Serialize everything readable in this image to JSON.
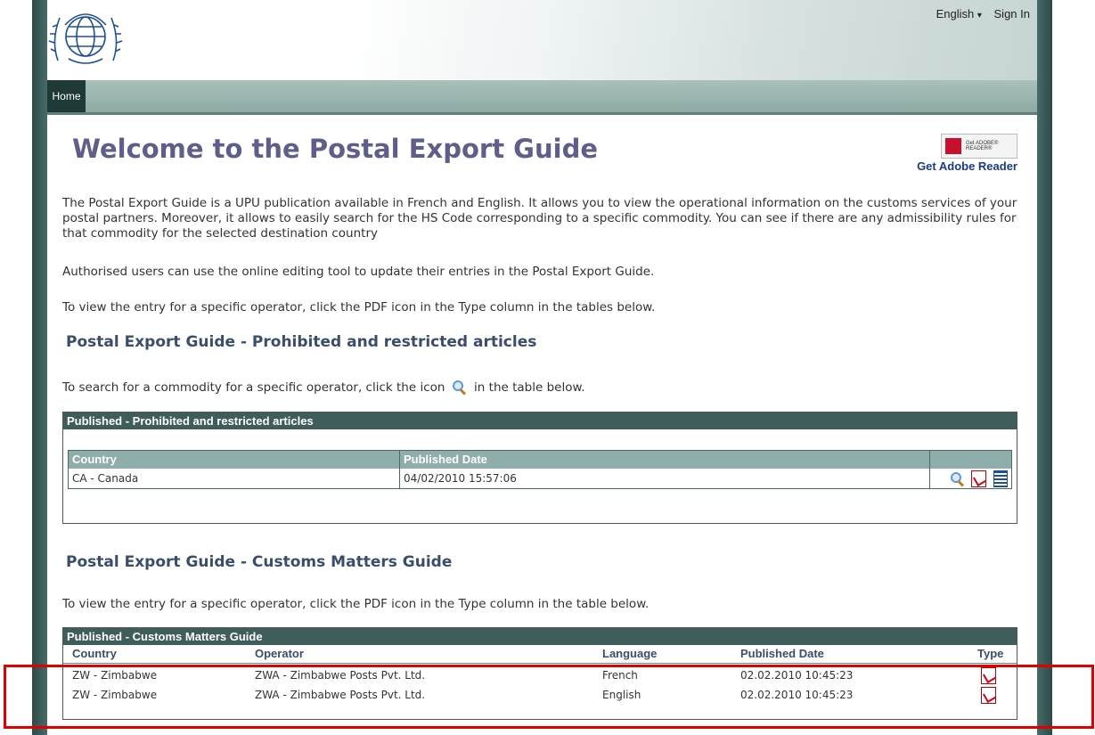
{
  "header": {
    "language_label": "English",
    "language_caret": "▾",
    "sign_in_label": "Sign In"
  },
  "nav": {
    "home_label": "Home"
  },
  "main": {
    "title": "Welcome to the Postal Export Guide",
    "adobe_badge_text": "Get ADOBE® READER®",
    "adobe_link": "Get Adobe Reader",
    "intro": "The Postal Export Guide is a UPU publication available in French and English. It allows you to view the operational information on the customs services of your postal partners. Moreover, it allows to easily search for the HS Code corresponding to a specific commodity. You can see if there are any admissibility rules for that commodity for the selected destination country",
    "authorised": "Authorised users can use the online editing tool to update their entries in the Postal Export Guide.",
    "view_entry": "To view the entry for a specific operator, click the PDF icon in the Type column in the tables below."
  },
  "section1": {
    "heading": "Postal Export Guide - Prohibited and restricted articles",
    "search_text_before": "To search for a commodity for a specific operator, click the icon",
    "search_text_after": "in the table below.",
    "panel_title": "Published - Prohibited and restricted articles",
    "col_country": "Country",
    "col_published": "Published Date",
    "rows": [
      {
        "country": "CA - Canada",
        "published": "04/02/2010 15:57:06"
      }
    ]
  },
  "section2": {
    "heading": "Postal Export Guide - Customs Matters Guide",
    "view_text": "To view the entry for a specific operator, click the PDF icon in the Type column in the table below.",
    "panel_title": "Published - Customs Matters Guide",
    "col_country": "Country",
    "col_operator": "Operator",
    "col_language": "Language",
    "col_published": "Published Date",
    "col_type": "Type",
    "rows": [
      {
        "country": "ZW - Zimbabwe",
        "operator": "ZWA - Zimbabwe Posts Pvt. Ltd.",
        "language": "French",
        "published": "02.02.2010 10:45:23"
      },
      {
        "country": "ZW - Zimbabwe",
        "operator": "ZWA - Zimbabwe Posts Pvt. Ltd.",
        "language": "English",
        "published": "02.02.2010 10:45:23"
      }
    ]
  },
  "colors": {
    "frame": "#3f5e5b",
    "title": "#5d5f8a",
    "heading": "#3a4d6a",
    "highlight": "#e00000"
  }
}
